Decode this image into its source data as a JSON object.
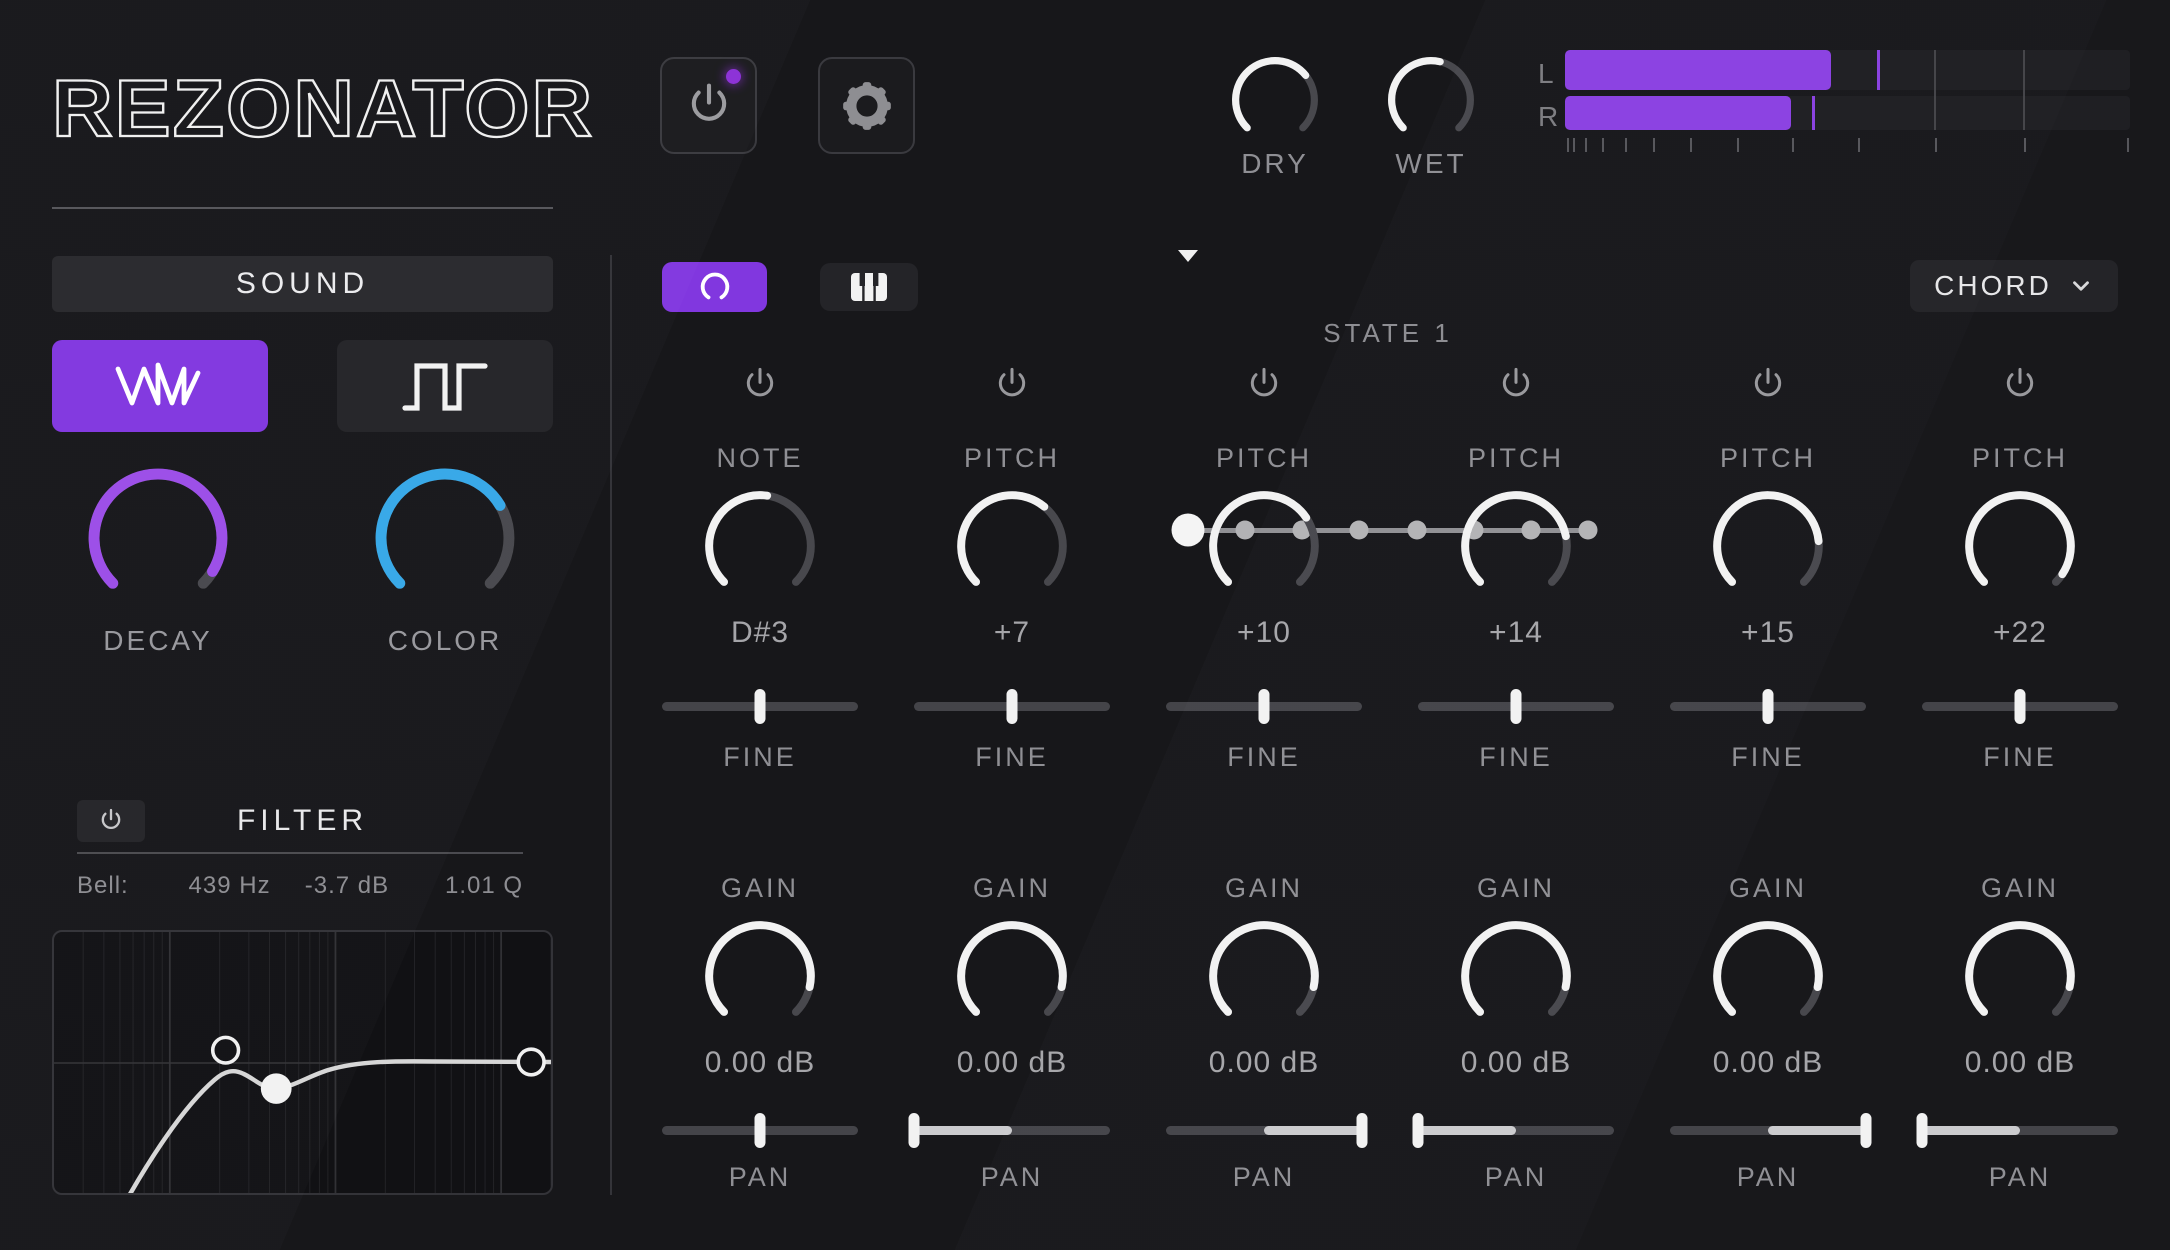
{
  "app": {
    "logo": "REZONATOR"
  },
  "colors": {
    "accent_purple": "#8A3FE1",
    "button_purple": "#8136DF",
    "knob_purple": "#9B4DE8",
    "knob_blue": "#35A7E8",
    "knob_white": "#f2f2f2",
    "led_purple": "#8B2FD6"
  },
  "header": {
    "power_button": {
      "on": true
    },
    "dry_knob": {
      "label": "DRY",
      "fill": 0.69
    },
    "wet_knob": {
      "label": "WET",
      "fill": 0.55
    },
    "meter": {
      "channels": [
        {
          "label": "L",
          "fill": 0.47,
          "peak": 0.552
        },
        {
          "label": "R",
          "fill": 0.4,
          "peak": 0.437
        }
      ],
      "gridlines": [
        0.655,
        0.813
      ],
      "ticks": [
        0.004,
        0.014,
        0.035,
        0.065,
        0.106,
        0.156,
        0.221,
        0.304,
        0.402,
        0.518,
        0.655,
        0.813,
        0.995
      ]
    }
  },
  "sound": {
    "title": "SOUND",
    "wave_buttons": [
      {
        "name": "sawtooth",
        "active": true
      },
      {
        "name": "square",
        "active": false
      }
    ],
    "decay_knob": {
      "label": "DECAY",
      "fill": 0.95
    },
    "color_knob": {
      "label": "COLOR",
      "fill": 0.72
    }
  },
  "filter": {
    "title": "FILTER",
    "enabled": true,
    "type": "Bell:",
    "freq": "439 Hz",
    "gain": "-3.7 dB",
    "q": "1.01 Q"
  },
  "resonator": {
    "mode_buttons": [
      {
        "name": "knob-mode",
        "active": true
      },
      {
        "name": "keyboard-mode",
        "active": false
      }
    ],
    "state": {
      "label": "STATE 1",
      "count": 8,
      "selected": 1
    },
    "chord": {
      "label": "CHORD"
    },
    "columns": [
      {
        "type": "NOTE",
        "value": "D#3",
        "pitch_fill": 0.53,
        "fine_label": "FINE",
        "fine_pos": 0.5,
        "gain_label": "GAIN",
        "gain_value": "0.00 dB",
        "gain_fill": 0.88,
        "pan_label": "PAN",
        "pan_pos": 0.5
      },
      {
        "type": "PITCH",
        "value": "+7",
        "pitch_fill": 0.646,
        "fine_label": "FINE",
        "fine_pos": 0.5,
        "gain_label": "GAIN",
        "gain_value": "0.00 dB",
        "gain_fill": 0.88,
        "pan_label": "PAN",
        "pan_pos": 0.0
      },
      {
        "type": "PITCH",
        "value": "+10",
        "pitch_fill": 0.708,
        "fine_label": "FINE",
        "fine_pos": 0.5,
        "gain_label": "GAIN",
        "gain_value": "0.00 dB",
        "gain_fill": 0.88,
        "pan_label": "PAN",
        "pan_pos": 1.0
      },
      {
        "type": "PITCH",
        "value": "+14",
        "pitch_fill": 0.792,
        "fine_label": "FINE",
        "fine_pos": 0.5,
        "gain_label": "GAIN",
        "gain_value": "0.00 dB",
        "gain_fill": 0.88,
        "pan_label": "PAN",
        "pan_pos": 0.0
      },
      {
        "type": "PITCH",
        "value": "+15",
        "pitch_fill": 0.813,
        "fine_label": "FINE",
        "fine_pos": 0.5,
        "gain_label": "GAIN",
        "gain_value": "0.00 dB",
        "gain_fill": 0.88,
        "pan_label": "PAN",
        "pan_pos": 1.0
      },
      {
        "type": "PITCH",
        "value": "+22",
        "pitch_fill": 0.958,
        "fine_label": "FINE",
        "fine_pos": 0.5,
        "gain_label": "GAIN",
        "gain_value": "0.00 dB",
        "gain_fill": 0.88,
        "pan_label": "PAN",
        "pan_pos": 0.0
      }
    ]
  }
}
